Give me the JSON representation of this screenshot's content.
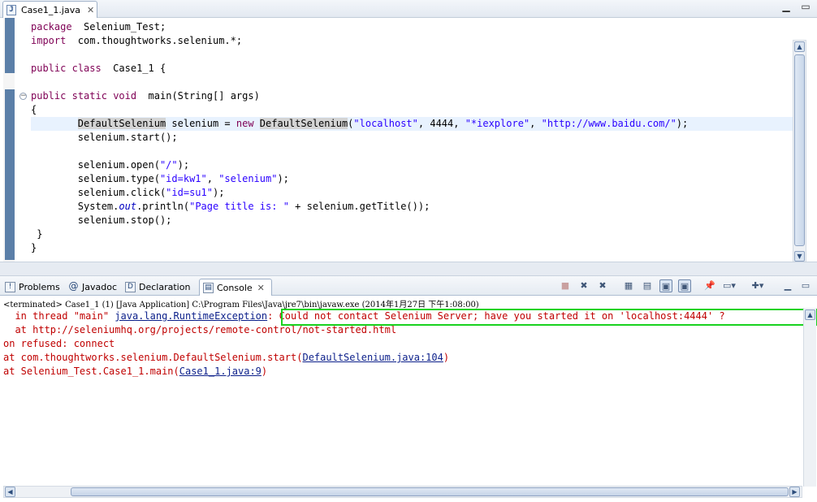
{
  "editor": {
    "tab_label": "Case1_1.java",
    "tab_icon": "java-file-icon",
    "lines": [
      {
        "parts": [
          [
            "kw",
            "package"
          ],
          [
            "",
            "  Selenium_Test;"
          ]
        ]
      },
      {
        "parts": [
          [
            "kw",
            "import"
          ],
          [
            "",
            "  com.thoughtworks.selenium.*;"
          ]
        ]
      },
      {
        "parts": [
          [
            "",
            ""
          ]
        ]
      },
      {
        "parts": [
          [
            "kw",
            "public"
          ],
          [
            "",
            " "
          ],
          [
            "kw",
            "class"
          ],
          [
            "",
            "  Case1_1 {"
          ]
        ]
      },
      {
        "parts": [
          [
            "",
            ""
          ]
        ]
      },
      {
        "parts": [
          [
            "kw",
            "public"
          ],
          [
            "",
            " "
          ],
          [
            "kw",
            "static"
          ],
          [
            "",
            " "
          ],
          [
            "kw",
            "void"
          ],
          [
            "",
            "  main(String[] args)"
          ]
        ]
      },
      {
        "parts": [
          [
            "",
            "{"
          ]
        ]
      },
      {
        "parts": [
          [
            "",
            "        "
          ],
          [
            "occ",
            "DefaultSelenium"
          ],
          [
            "",
            " selenium = "
          ],
          [
            "kw",
            "new"
          ],
          [
            "",
            " "
          ],
          [
            "occ",
            "DefaultSelenium"
          ],
          [
            "",
            "("
          ],
          [
            "str",
            "\"localhost\""
          ],
          [
            "",
            ", 4444, "
          ],
          [
            "str",
            "\"*iexplore\""
          ],
          [
            "",
            ", "
          ],
          [
            "str",
            "\"http://www.baidu.com/\""
          ],
          [
            "",
            ");"
          ]
        ]
      },
      {
        "parts": [
          [
            "",
            "        selenium.start();"
          ]
        ]
      },
      {
        "parts": [
          [
            "",
            ""
          ]
        ]
      },
      {
        "parts": [
          [
            "",
            "        selenium.open("
          ],
          [
            "str",
            "\"/\""
          ],
          [
            "",
            ");"
          ]
        ]
      },
      {
        "parts": [
          [
            "",
            "        selenium.type("
          ],
          [
            "str",
            "\"id=kw1\""
          ],
          [
            "",
            ", "
          ],
          [
            "str",
            "\"selenium\""
          ],
          [
            "",
            ");"
          ]
        ]
      },
      {
        "parts": [
          [
            "",
            "        selenium.click("
          ],
          [
            "str",
            "\"id=su1\""
          ],
          [
            "",
            ");"
          ]
        ]
      },
      {
        "parts": [
          [
            "",
            "        System."
          ],
          [
            "fld",
            "out"
          ],
          [
            "",
            ".println("
          ],
          [
            "str",
            "\"Page title is: \""
          ],
          [
            "",
            " + selenium.getTitle());"
          ]
        ]
      },
      {
        "parts": [
          [
            "",
            "        selenium.stop();"
          ]
        ]
      },
      {
        "parts": [
          [
            "",
            " }"
          ]
        ]
      },
      {
        "parts": [
          [
            "",
            "}"
          ]
        ]
      }
    ]
  },
  "panel": {
    "tabs": [
      {
        "label": "Problems",
        "icon": "problems-icon",
        "active": false
      },
      {
        "label": "Javadoc",
        "icon": "javadoc-at-icon",
        "active": false
      },
      {
        "label": "Declaration",
        "icon": "declaration-icon",
        "active": false
      },
      {
        "label": "Console",
        "icon": "console-icon",
        "active": true
      }
    ],
    "console_description": "<terminated> Case1_1 (1) [Java Application] C:\\Program Files\\Java\\jre7\\bin\\javaw.exe (2014年1月27日 下午1:08:00)",
    "output_lines": [
      {
        "parts": [
          [
            "",
            "  in thread \"main\" "
          ],
          [
            "link",
            "java.lang.RuntimeException"
          ],
          [
            "",
            ": Could not contact Selenium Server; have you started it on 'localhost:4444' ?"
          ]
        ]
      },
      {
        "parts": [
          [
            "",
            "  at http://seleniumhq.org/projects/remote-control/not-started.html"
          ]
        ]
      },
      {
        "parts": [
          [
            "",
            "on refused: connect"
          ]
        ]
      },
      {
        "parts": [
          [
            "",
            "at com.thoughtworks.selenium.DefaultSelenium.start("
          ],
          [
            "link",
            "DefaultSelenium.java:104"
          ],
          [
            "",
            ")"
          ]
        ]
      },
      {
        "parts": [
          [
            "",
            "at Selenium_Test.Case1_1.main("
          ],
          [
            "link",
            "Case1_1.java:9"
          ],
          [
            "",
            ")"
          ]
        ]
      }
    ]
  },
  "colors": {
    "keyword": "#7f0055",
    "string": "#2a00ff",
    "error_text": "#c00000",
    "highlight_box": "#19d21f"
  }
}
